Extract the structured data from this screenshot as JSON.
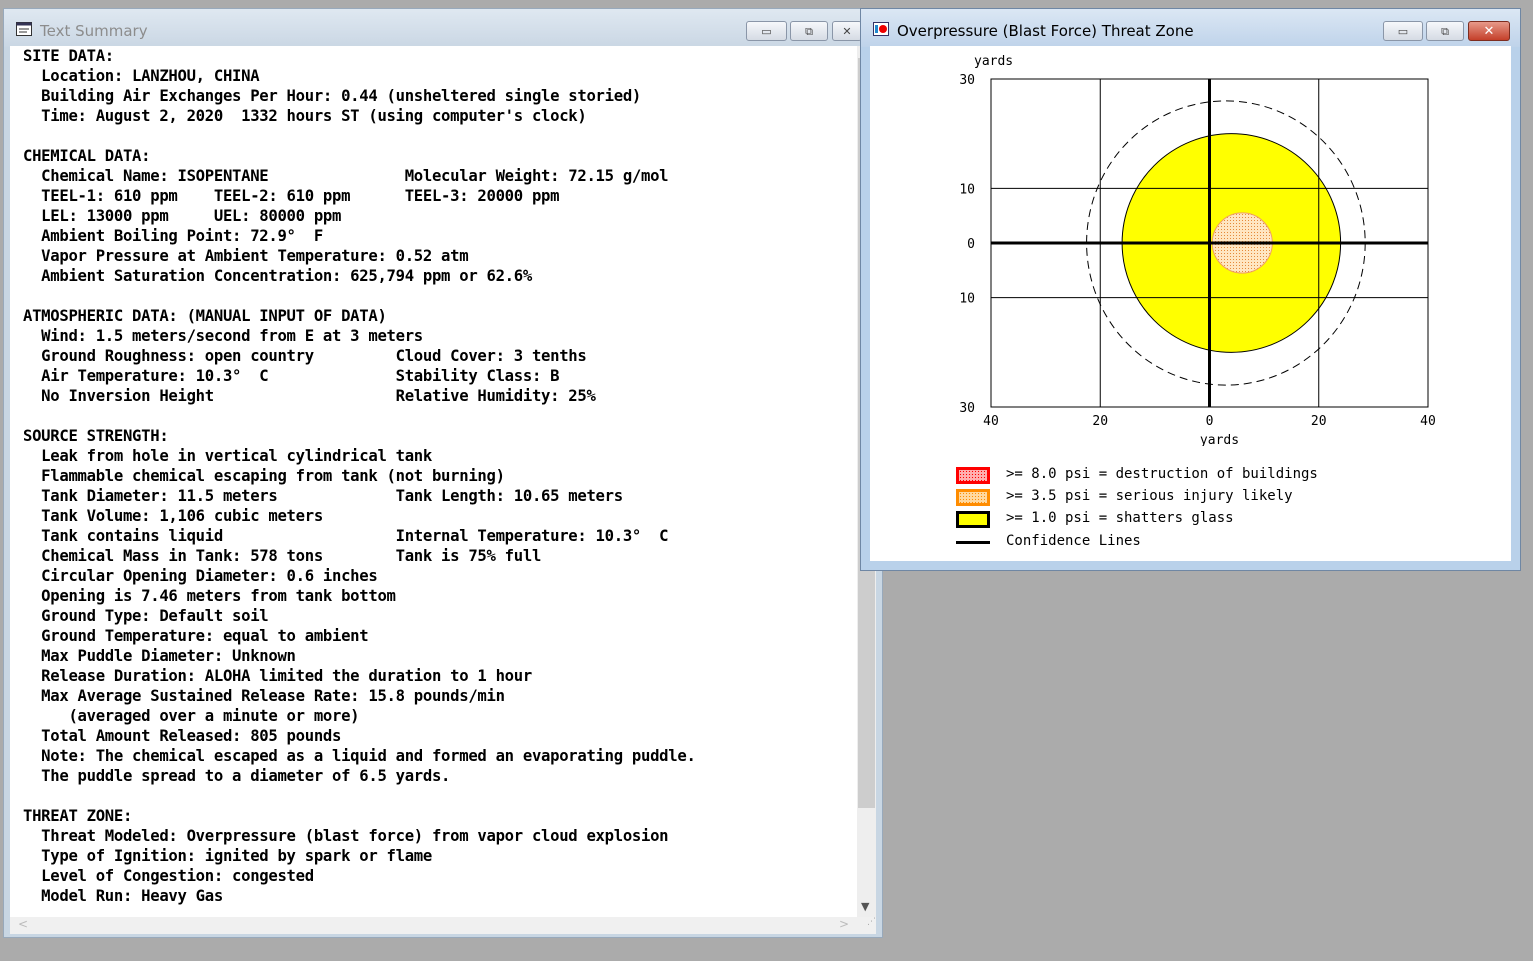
{
  "summary_window": {
    "title": "Text Summary",
    "lines": [
      "SITE DATA:",
      "  Location: LANZHOU, CHINA",
      "  Building Air Exchanges Per Hour: 0.44 (unsheltered single storied)",
      "  Time: August 2, 2020  1332 hours ST (using computer's clock)",
      "",
      "CHEMICAL DATA:",
      "  Chemical Name: ISOPENTANE               Molecular Weight: 72.15 g/mol",
      "  TEEL-1: 610 ppm    TEEL-2: 610 ppm      TEEL-3: 20000 ppm",
      "  LEL: 13000 ppm     UEL: 80000 ppm",
      "  Ambient Boiling Point: 72.9°  F",
      "  Vapor Pressure at Ambient Temperature: 0.52 atm",
      "  Ambient Saturation Concentration: 625,794 ppm or 62.6%",
      "",
      "ATMOSPHERIC DATA: (MANUAL INPUT OF DATA)",
      "  Wind: 1.5 meters/second from E at 3 meters",
      "  Ground Roughness: open country         Cloud Cover: 3 tenths",
      "  Air Temperature: 10.3°  C              Stability Class: B",
      "  No Inversion Height                    Relative Humidity: 25%",
      "",
      "SOURCE STRENGTH:",
      "  Leak from hole in vertical cylindrical tank",
      "  Flammable chemical escaping from tank (not burning)",
      "  Tank Diameter: 11.5 meters             Tank Length: 10.65 meters",
      "  Tank Volume: 1,106 cubic meters",
      "  Tank contains liquid                   Internal Temperature: 10.3°  C",
      "  Chemical Mass in Tank: 578 tons        Tank is 75% full",
      "  Circular Opening Diameter: 0.6 inches",
      "  Opening is 7.46 meters from tank bottom",
      "  Ground Type: Default soil",
      "  Ground Temperature: equal to ambient",
      "  Max Puddle Diameter: Unknown",
      "  Release Duration: ALOHA limited the duration to 1 hour",
      "  Max Average Sustained Release Rate: 15.8 pounds/min",
      "     (averaged over a minute or more)",
      "  Total Amount Released: 805 pounds",
      "  Note: The chemical escaped as a liquid and formed an evaporating puddle.",
      "  The puddle spread to a diameter of 6.5 yards.",
      "",
      "THREAT ZONE:",
      "  Threat Modeled: Overpressure (blast force) from vapor cloud explosion",
      "  Type of Ignition: ignited by spark or flame",
      "  Level of Congestion: congested",
      "  Model Run: Heavy Gas"
    ],
    "buttons": {
      "minimize": "▭",
      "restore": "⧉",
      "close": "✕"
    }
  },
  "threat_window": {
    "title": "Overpressure (Blast Force) Threat Zone",
    "buttons": {
      "minimize": "▭",
      "restore": "⧉",
      "close": "✕"
    },
    "legend": [
      {
        "label": ">= 8.0 psi = destruction of buildings",
        "border": "#ff0000",
        "fill": "#ffb0b0",
        "pattern": "dots"
      },
      {
        "label": ">= 3.5 psi = serious injury likely",
        "border": "#ff8c00",
        "fill": "#ffd9a0",
        "pattern": "dots"
      },
      {
        "label": ">= 1.0 psi = shatters glass",
        "border": "#000000",
        "fill": "#ffff00",
        "pattern": "solid"
      },
      {
        "label": "Confidence Lines",
        "border": "#000000",
        "fill": "",
        "pattern": "line"
      }
    ]
  },
  "chart_data": {
    "type": "threat-zone",
    "xlabel": "yards",
    "ylabel": "yards",
    "xlim": [
      -40,
      40
    ],
    "ylim": [
      -30,
      30
    ],
    "x_ticks": [
      {
        "value": -40,
        "label": "40"
      },
      {
        "value": -20,
        "label": "20"
      },
      {
        "value": 0,
        "label": "0"
      },
      {
        "value": 20,
        "label": "20"
      },
      {
        "value": 40,
        "label": "40"
      }
    ],
    "y_ticks": [
      {
        "value": 30,
        "label": "30"
      },
      {
        "value": 10,
        "label": "10"
      },
      {
        "value": 0,
        "label": "0"
      },
      {
        "value": -10,
        "label": "10"
      },
      {
        "value": -30,
        "label": "30"
      }
    ],
    "grid": true,
    "zones": [
      {
        "name": ">= 1.0 psi",
        "center_x": 4,
        "center_y": 0,
        "radius": 20,
        "color": "#ffff00"
      },
      {
        "name": ">= 3.5 psi",
        "center_x": 6,
        "center_y": 0,
        "radius": 5.5,
        "color": "#ffd9a0"
      }
    ],
    "confidence_ellipse": {
      "center_x": 3,
      "center_y": 0,
      "radius_x": 25.5,
      "radius_y": 26
    }
  }
}
